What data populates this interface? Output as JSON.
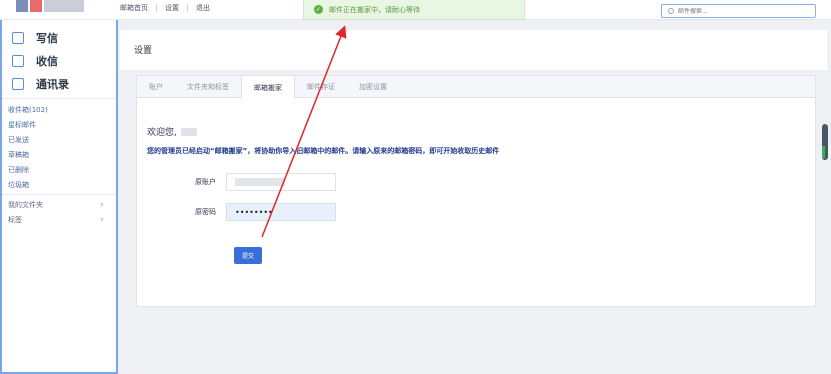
{
  "topnav": {
    "items": [
      "邮箱首页",
      "设置",
      "退出"
    ]
  },
  "toast": {
    "text": "邮件正在搬家中，请耐心等待"
  },
  "search": {
    "placeholder": "邮件搜索..."
  },
  "sidebar": {
    "big_items": [
      {
        "label": "写信",
        "icon": "compose-icon"
      },
      {
        "label": "收信",
        "icon": "inbox-icon"
      },
      {
        "label": "通讯录",
        "icon": "contacts-icon"
      }
    ],
    "folders": [
      "收件箱(102)",
      "星标邮件",
      "已发送",
      "草稿箱",
      "已删除",
      "垃圾箱"
    ],
    "expandables": [
      "我的文件夹",
      "标签"
    ]
  },
  "page": {
    "title": "设置"
  },
  "tabs": [
    "账户",
    "文件夹和标签",
    "邮箱搬家",
    "邮件存证",
    "加密设置"
  ],
  "active_tab": "邮箱搬家",
  "content": {
    "welcome": "欢迎您,",
    "notice": "您的管理员已经启动“邮箱搬家”，将协助你导入旧邮箱中的邮件。请输入原来的邮箱密码，即可开始收取历史邮件",
    "account_label": "原账户",
    "password_label": "原密码",
    "password_value": "••••••••",
    "submit_label": "提交"
  },
  "colors": {
    "accent": "#3a6fd8",
    "toast_bg": "#e8f6e3",
    "toast_text": "#5a9a3c",
    "notice_text": "#1f3b8a",
    "annotation_arrow": "#e0262b"
  }
}
